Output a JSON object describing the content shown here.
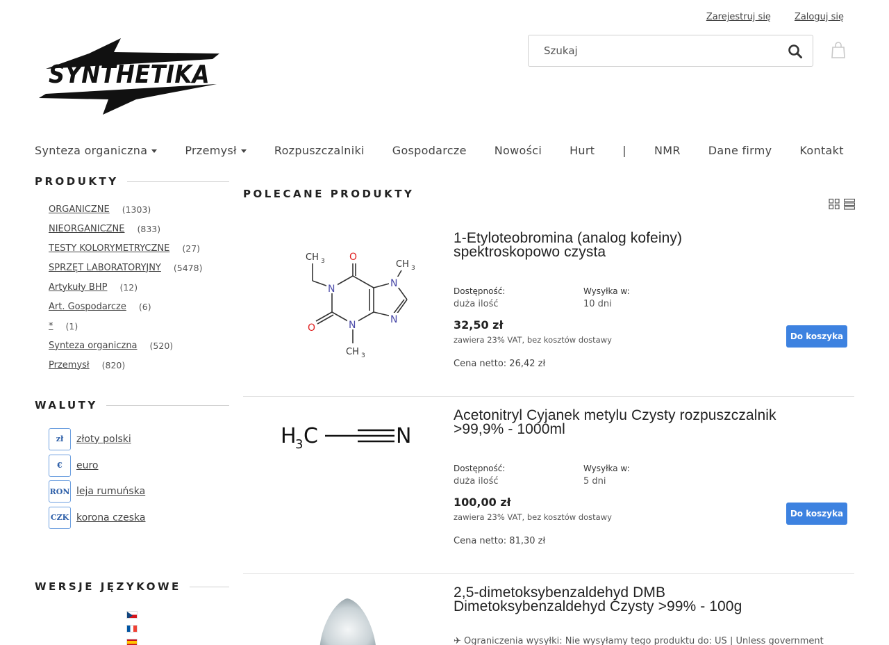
{
  "header": {
    "register_label": "Zarejestruj się",
    "login_label": "Zaloguj się",
    "logo_text": "SYNTHETIKA",
    "search_placeholder": "Szukaj"
  },
  "nav": [
    {
      "label": "Synteza organiczna",
      "dropdown": true
    },
    {
      "label": "Przemysł",
      "dropdown": true
    },
    {
      "label": "Rozpuszczalniki",
      "dropdown": false
    },
    {
      "label": "Gospodarcze",
      "dropdown": false
    },
    {
      "label": "Nowości",
      "dropdown": false
    },
    {
      "label": "Hurt",
      "dropdown": false
    },
    {
      "label": "|",
      "dropdown": false
    },
    {
      "label": "NMR",
      "dropdown": false
    },
    {
      "label": "Dane firmy",
      "dropdown": false
    },
    {
      "label": "Kontakt",
      "dropdown": false
    }
  ],
  "sidebar": {
    "products_heading": "PRODUKTY",
    "categories": [
      {
        "name": "ORGANICZNE",
        "count": "(1303)"
      },
      {
        "name": "NIEORGANICZNE",
        "count": "(833)"
      },
      {
        "name": "TESTY KOLORYMETRYCZNE",
        "count": "(27)"
      },
      {
        "name": "SPRZĘT LABORATORYJNY",
        "count": "(5478)"
      },
      {
        "name": "Artykuły BHP",
        "count": "(12)"
      },
      {
        "name": "Art. Gospodarcze",
        "count": "(6)"
      },
      {
        "name": "*",
        "count": "(1)"
      },
      {
        "name": "Synteza organiczna",
        "count": "(520)"
      },
      {
        "name": "Przemysł",
        "count": "(820)"
      }
    ],
    "currency_heading": "WALUTY",
    "currencies": [
      {
        "symbol": "zł",
        "label": "złoty polski"
      },
      {
        "symbol": "€",
        "label": "euro"
      },
      {
        "symbol": "RON",
        "label": "leja rumuńska"
      },
      {
        "symbol": "CZK",
        "label": "korona czeska"
      }
    ],
    "language_heading": "WERSJE JĘZYKOWE"
  },
  "main": {
    "heading": "POLECANE PRODUKTY",
    "products": [
      {
        "title_line1": "1-Etyloteobromina (analog kofeiny)",
        "title_line2": "spektroskopowo czysta",
        "availability_label": "Dostępność:",
        "availability_value": "duża ilość",
        "shipping_label": "Wysyłka w:",
        "shipping_value": "10 dni",
        "price": "32,50 zł",
        "vat_note": "zawiera 23% VAT, bez kosztów dostawy",
        "netto": "Cena netto: 26,42 zł",
        "button": "Do koszyka"
      },
      {
        "title_line1": "Acetonitryl Cyjanek metylu Czysty rozpuszczalnik",
        "title_line2": ">99,9% - 1000ml",
        "availability_label": "Dostępność:",
        "availability_value": "duża ilość",
        "shipping_label": "Wysyłka w:",
        "shipping_value": "5 dni",
        "price": "100,00 zł",
        "vat_note": "zawiera 23% VAT, bez kosztów dostawy",
        "netto": "Cena netto: 81,30 zł",
        "button": "Do koszyka"
      },
      {
        "title_line1": "2,5-dimetoksybenzaldehyd DMB",
        "title_line2": "Dimetoksybenzaldehyd Czysty >99% - 100g",
        "note": "✈ Ograniczenia wysyłki: Nie wysyłamy tego produktu do: US | Unless government"
      }
    ]
  },
  "molecule_labels": {
    "ch3": "CH",
    "sub3": "3",
    "o": "O",
    "n": "N",
    "h": "H",
    "c": "C"
  }
}
